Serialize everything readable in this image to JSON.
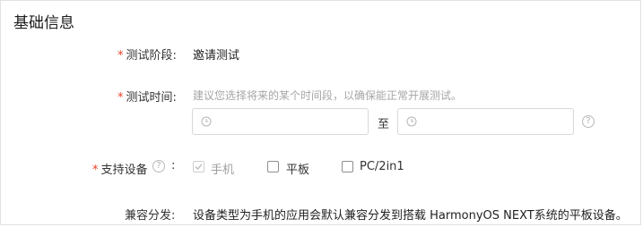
{
  "section_title": "基础信息",
  "test_stage": {
    "label": "测试阶段:",
    "value": "邀请测试"
  },
  "test_time": {
    "label": "测试时间:",
    "hint": "建议您选择将来的某个时间段，以确保能正常开展测试。",
    "separator": "至"
  },
  "devices": {
    "label": "支持设备",
    "colon": ":",
    "options": [
      {
        "label": "手机",
        "checked": true,
        "disabled": true
      },
      {
        "label": "平板",
        "checked": false,
        "disabled": false
      },
      {
        "label": "PC/2in1",
        "checked": false,
        "disabled": false
      }
    ]
  },
  "compat": {
    "label": "兼容分发:",
    "text": "设备类型为手机的应用会默认兼容分发到搭载 HarmonyOS NEXT系统的平板设备。"
  },
  "colors": {
    "required": "#e84026",
    "hint": "#a6a6a6"
  }
}
